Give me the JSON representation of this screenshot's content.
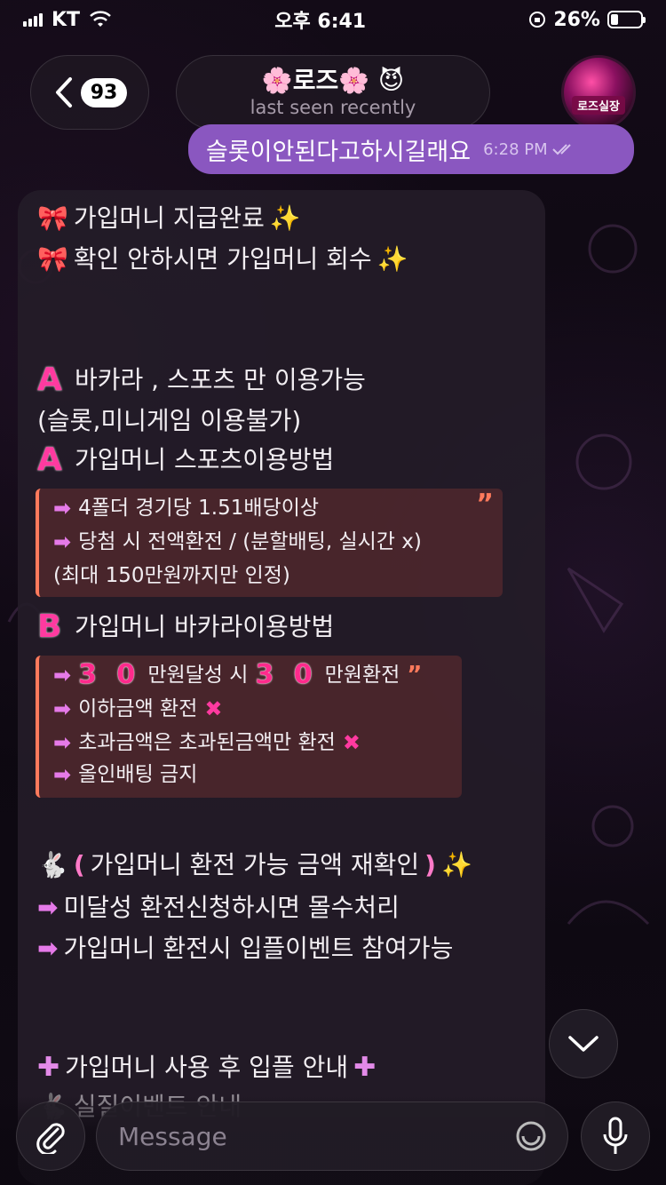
{
  "status_bar": {
    "carrier": "KT",
    "time": "오후 6:41",
    "battery": "26%"
  },
  "header": {
    "unread_count": "93",
    "title": "🌸로즈🌸 😈",
    "subtitle": "last seen recently"
  },
  "outgoing": {
    "text": "슬롯이안된다고하시길래요",
    "time": "6:28 PM"
  },
  "message": {
    "line1": "가입머니 지급완료",
    "line2": "확인 안하시면 가입머니 회수",
    "line3": "바카라 , 스포츠 만 이용가능",
    "line4": "(슬롯,미니게임 이용불가)",
    "line5": "가입머니 스포츠이용방법",
    "sports": {
      "q1": "4폴더 경기당 1.51배당이상",
      "q2": "당첨 시 전액환전 /  (분할배팅, 실시간  x)",
      "q3": "(최대 150만원까지만 인정)"
    },
    "line6": "가입머니 바카라이용방법",
    "baccarat": {
      "num1": "3 0",
      "q1a": "만원달성 시",
      "num2": "3 0",
      "q1b": "만원환전",
      "q2": "이하금액 환전",
      "q3": "초과금액은 초과된금액만 환전",
      "q4": "올인배팅 금지"
    },
    "line7": "가입머니 환전 가능 금액 재확인",
    "line8": "미달성 환전신청하시면 몰수처리",
    "line9": "가입머니 환전시 입플이벤트 참여가능",
    "line10": "가입머니 사용 후 입플 안내",
    "line11": "실질이벤트 안내",
    "letter_a": "A",
    "letter_b": "B"
  },
  "input": {
    "placeholder": "Message"
  },
  "colors": {
    "outgoing_bubble": "#8a57c0",
    "accent_pink": "#ff3aa0",
    "quote_border": "#ff7a5c"
  }
}
